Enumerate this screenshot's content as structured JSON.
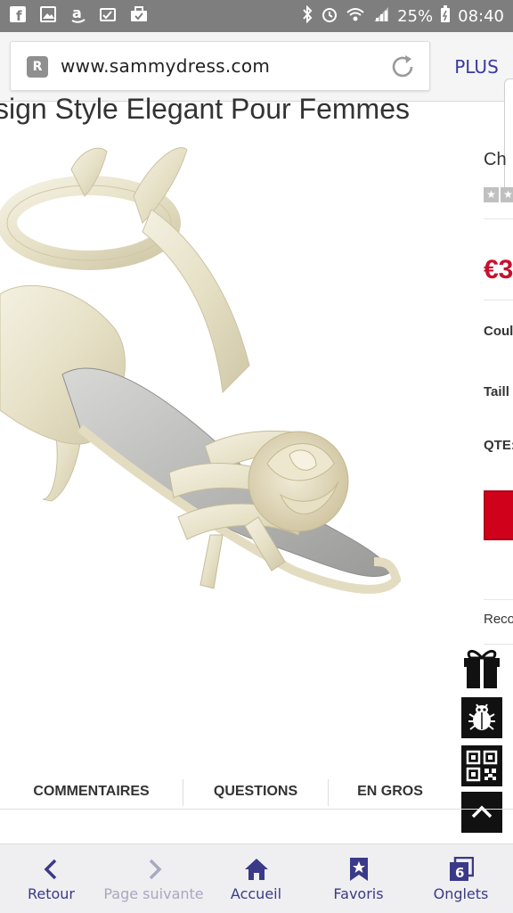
{
  "status_bar": {
    "battery": "25%",
    "time": "08:40"
  },
  "browser": {
    "url": "www.sammydress.com",
    "plus_label": "PLUS"
  },
  "page": {
    "title": "sign Style Elegant Pour Femmes",
    "side": {
      "name_fragment": "Ch",
      "price_fragment": "€3",
      "color_label": "Coul",
      "size_label": "Taill",
      "qty_label": "QTE:",
      "recommend_label": "Reco"
    },
    "tabs": [
      "COMMENTAIRES",
      "QUESTIONS",
      "EN GROS"
    ]
  },
  "bottom_nav": {
    "items": [
      {
        "label": "Retour",
        "icon": "chevron-left-icon"
      },
      {
        "label": "Page suivante",
        "icon": "chevron-right-icon"
      },
      {
        "label": "Accueil",
        "icon": "home-icon"
      },
      {
        "label": "Favoris",
        "icon": "bookmark-star-icon"
      },
      {
        "label": "Onglets",
        "icon": "tabs-icon",
        "count": "6"
      }
    ]
  },
  "colors": {
    "accent": "#3a3a88",
    "price": "#c8102e",
    "status_bar": "#7e7e7e"
  }
}
